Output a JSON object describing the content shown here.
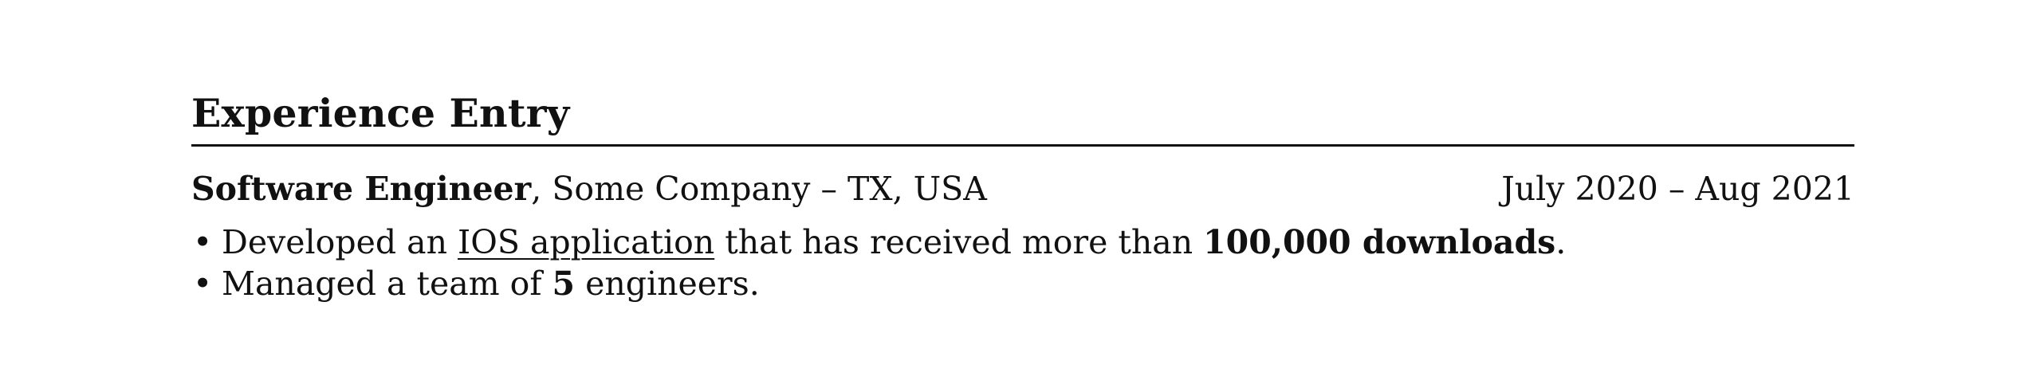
{
  "section": {
    "title": "Experience Entry"
  },
  "entry": {
    "role": "Software Engineer",
    "company_sep": ", ",
    "company": "Some Company – TX, USA",
    "dates": "July 2020 – Aug 2021"
  },
  "bullets": [
    {
      "marker": "•",
      "t1": "Developed an ",
      "link": "IOS application",
      "t2": " that has received more than ",
      "bold": "100,000 downloads",
      "t3": "."
    },
    {
      "marker": "•",
      "t1": "Managed a team of ",
      "bold": "5",
      "t2": " engineers."
    }
  ]
}
